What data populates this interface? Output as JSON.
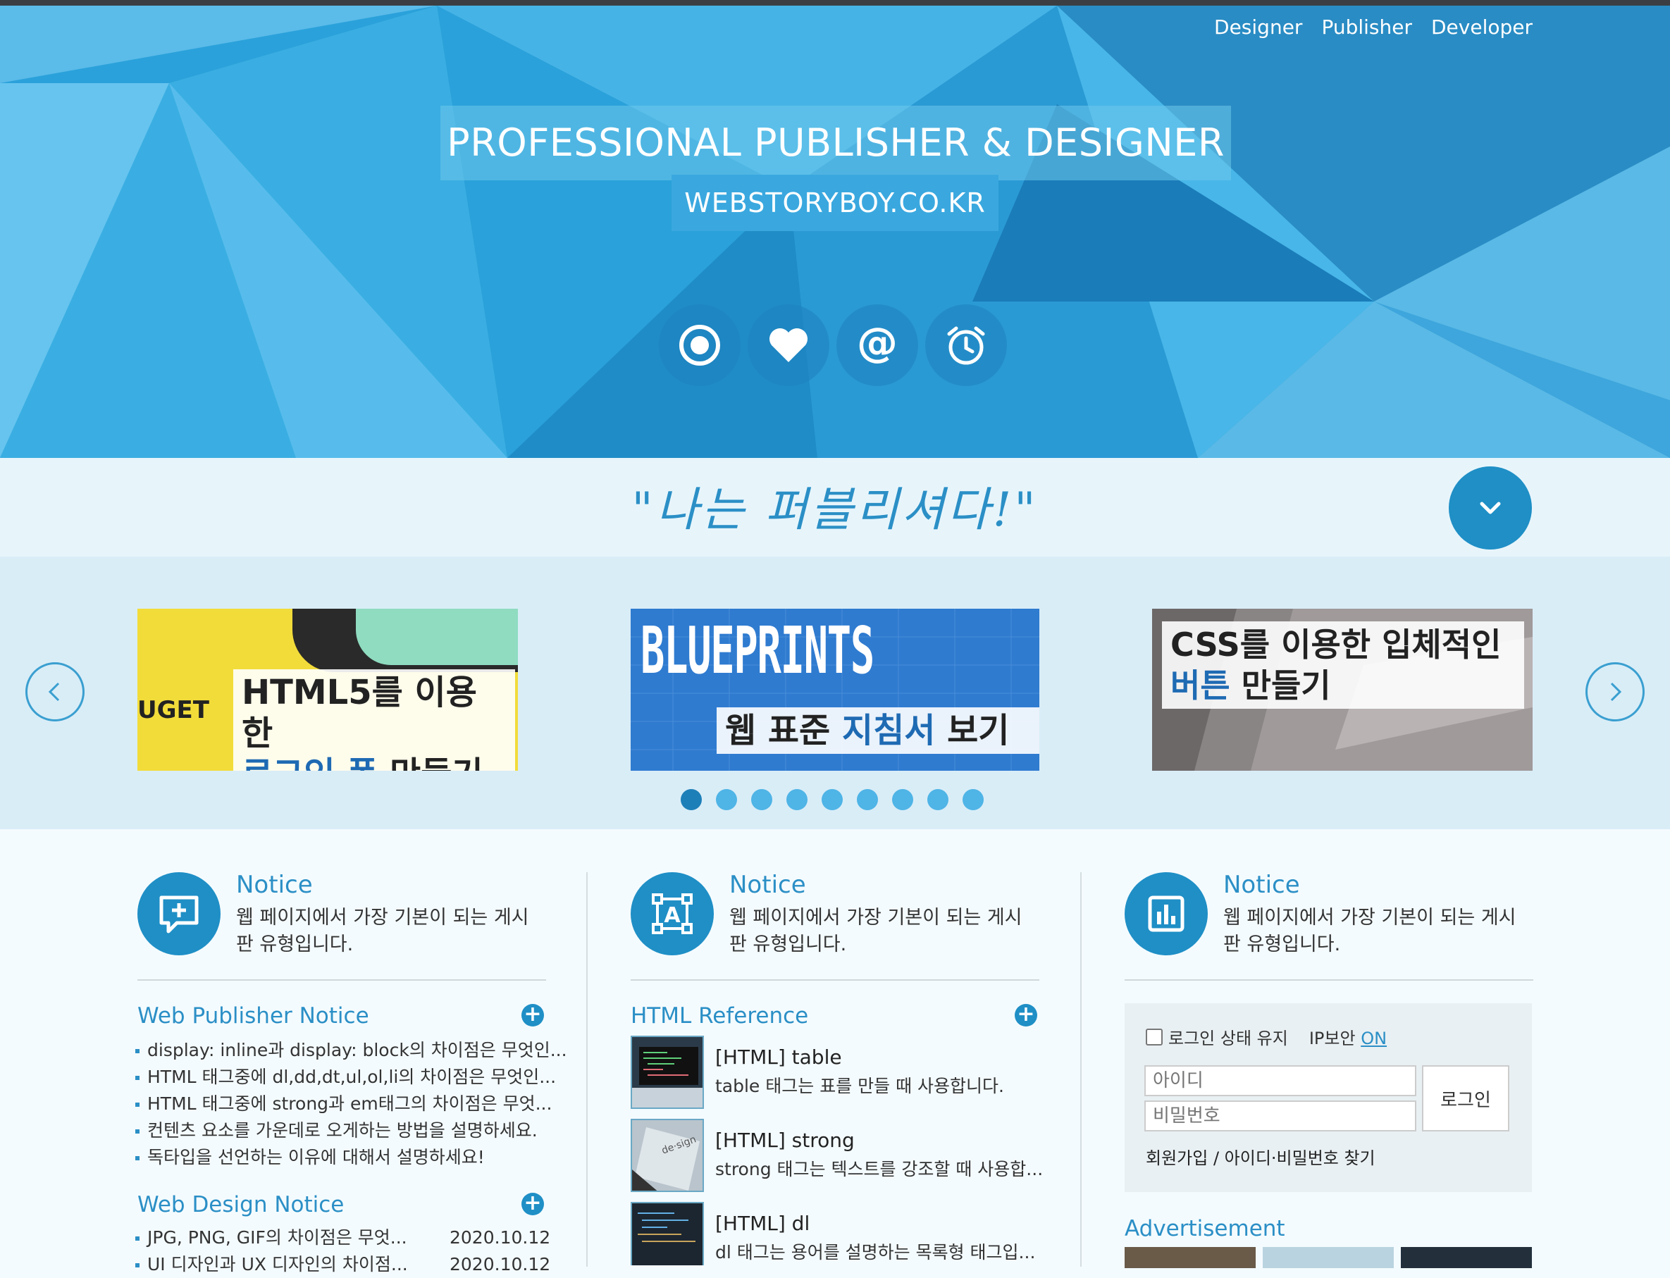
{
  "nav": {
    "items": [
      "Designer",
      "Publisher",
      "Developer"
    ]
  },
  "hero": {
    "title": "PROFESSIONAL PUBLISHER & DESIGNER",
    "subtitle": "WEBSTORYBOY.CO.KR",
    "icons": [
      "record-icon",
      "heart-icon",
      "at-icon",
      "alarm-clock-icon"
    ]
  },
  "slogan": "\"나는 퍼블리셔다!\"",
  "slides": [
    {
      "brand": "UGET",
      "line1": "HTML5를 이용한",
      "line2_hl": "로그인 폼",
      "line2_rest": " 만들기"
    },
    {
      "brand": "BLUEPRINTS",
      "line1_a": "웹 표준 ",
      "line1_hl": "지침서",
      "line1_b": " 보기"
    },
    {
      "line1": "CSS를 이용한 입체적인",
      "line2_hl": "버튼",
      "line2_rest": " 만들기"
    }
  ],
  "carousel": {
    "dot_count": 9,
    "active_index": 0
  },
  "columns": [
    {
      "title": "Notice",
      "desc": "웹 페이지에서 가장 기본이 되는 게시판 유형입니다.",
      "icon": "add-comment-icon"
    },
    {
      "title": "Notice",
      "desc": "웹 페이지에서 가장 기본이 되는 게시판 유형입니다.",
      "icon": "text-select-icon"
    },
    {
      "title": "Notice",
      "desc": "웹 페이지에서 가장 기본이 되는 게시판 유형입니다.",
      "icon": "bar-chart-icon"
    }
  ],
  "web_publisher_notice": {
    "title": "Web Publisher Notice",
    "items": [
      "display: inline과 display: block의 차이점은 무엇인...",
      "HTML 태그중에 dl,dd,dt,ul,ol,li의 차이점은 무엇인...",
      "HTML 태그중에 strong과 em태그의 차이점은 무엇...",
      "컨텐츠 요소를 가운데로 오게하는 방법을 설명하세요.",
      "독타입을 선언하는 이유에 대해서 설명하세요!"
    ]
  },
  "web_design_notice": {
    "title": "Web Design Notice",
    "items": [
      {
        "text": "JPG, PNG, GIF의 차이점은 무엇...",
        "date": "2020.10.12"
      },
      {
        "text": "UI 디자인과 UX 디자인의 차이점...",
        "date": "2020.10.12"
      }
    ]
  },
  "html_reference": {
    "title": "HTML Reference",
    "items": [
      {
        "title": "[HTML] table",
        "desc": "table 태그는 표를 만들 때 사용합니다."
      },
      {
        "title": "[HTML] strong",
        "desc": "strong 태그는 텍스트를 강조할 때 사용합..."
      },
      {
        "title": "[HTML] dl",
        "desc": "dl 태그는 용어를 설명하는 목록형 태그입..."
      }
    ]
  },
  "login": {
    "keep_label": "로그인 상태 유지",
    "ip_label": "IP보안",
    "ip_value": "ON",
    "id_placeholder": "아이디",
    "pw_placeholder": "비밀번호",
    "button": "로그인",
    "links": "회원가입 / 아이디·비밀번호 찾기"
  },
  "advertisement": {
    "title": "Advertisement"
  },
  "colors": {
    "primary": "#1f8fc6",
    "hero": "#2a9fd8",
    "accent_text": "#2b8fc6"
  }
}
